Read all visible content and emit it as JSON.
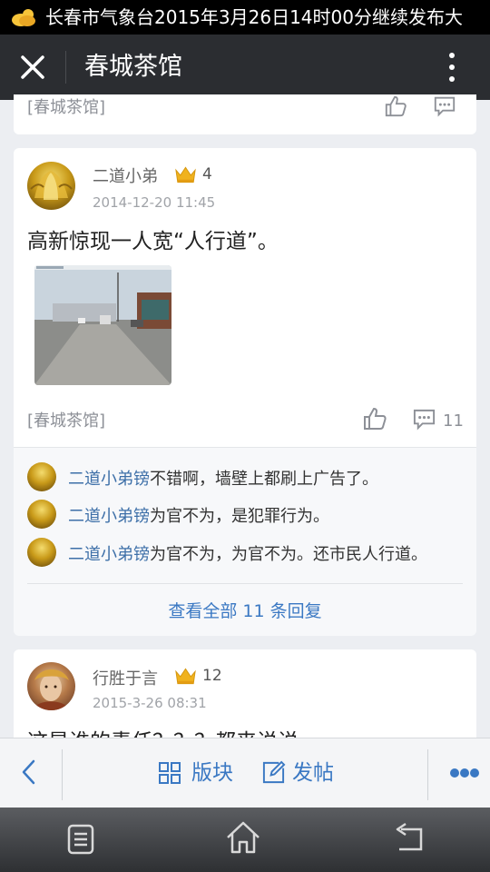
{
  "status_bar": {
    "notification": "长春市气象台2015年3月26日14时00分继续发布大"
  },
  "app_bar": {
    "title": "春城茶馆"
  },
  "prev_card": {
    "tag": "[春城茶馆]"
  },
  "post1": {
    "author": "二道小弟",
    "level": "4",
    "time": "2014-12-20 11:45",
    "content": "高新惊现一人宽“人行道”。",
    "tag": "[春城茶馆]",
    "comment_count": "11",
    "replies": [
      {
        "user": "二道小弟镑",
        "text": "不错啊，墙壁上都刷上广告了。"
      },
      {
        "user": "二道小弟镑",
        "text": "为官不为，是犯罪行为。"
      },
      {
        "user": "二道小弟镑",
        "text": "为官不为，为官不为。还市民人行道。"
      }
    ],
    "view_all": "查看全部 11 条回复"
  },
  "post2": {
    "author": "行胜于言",
    "level": "12",
    "time": "2015-3-26 08:31",
    "content": "这是谁的责任？？？都来说说"
  },
  "toolbar": {
    "board_label": "版块",
    "post_label": "发帖"
  },
  "colors": {
    "accent": "#3a78c3",
    "link": "#3d6fa8",
    "crown": "#f0b21e"
  }
}
